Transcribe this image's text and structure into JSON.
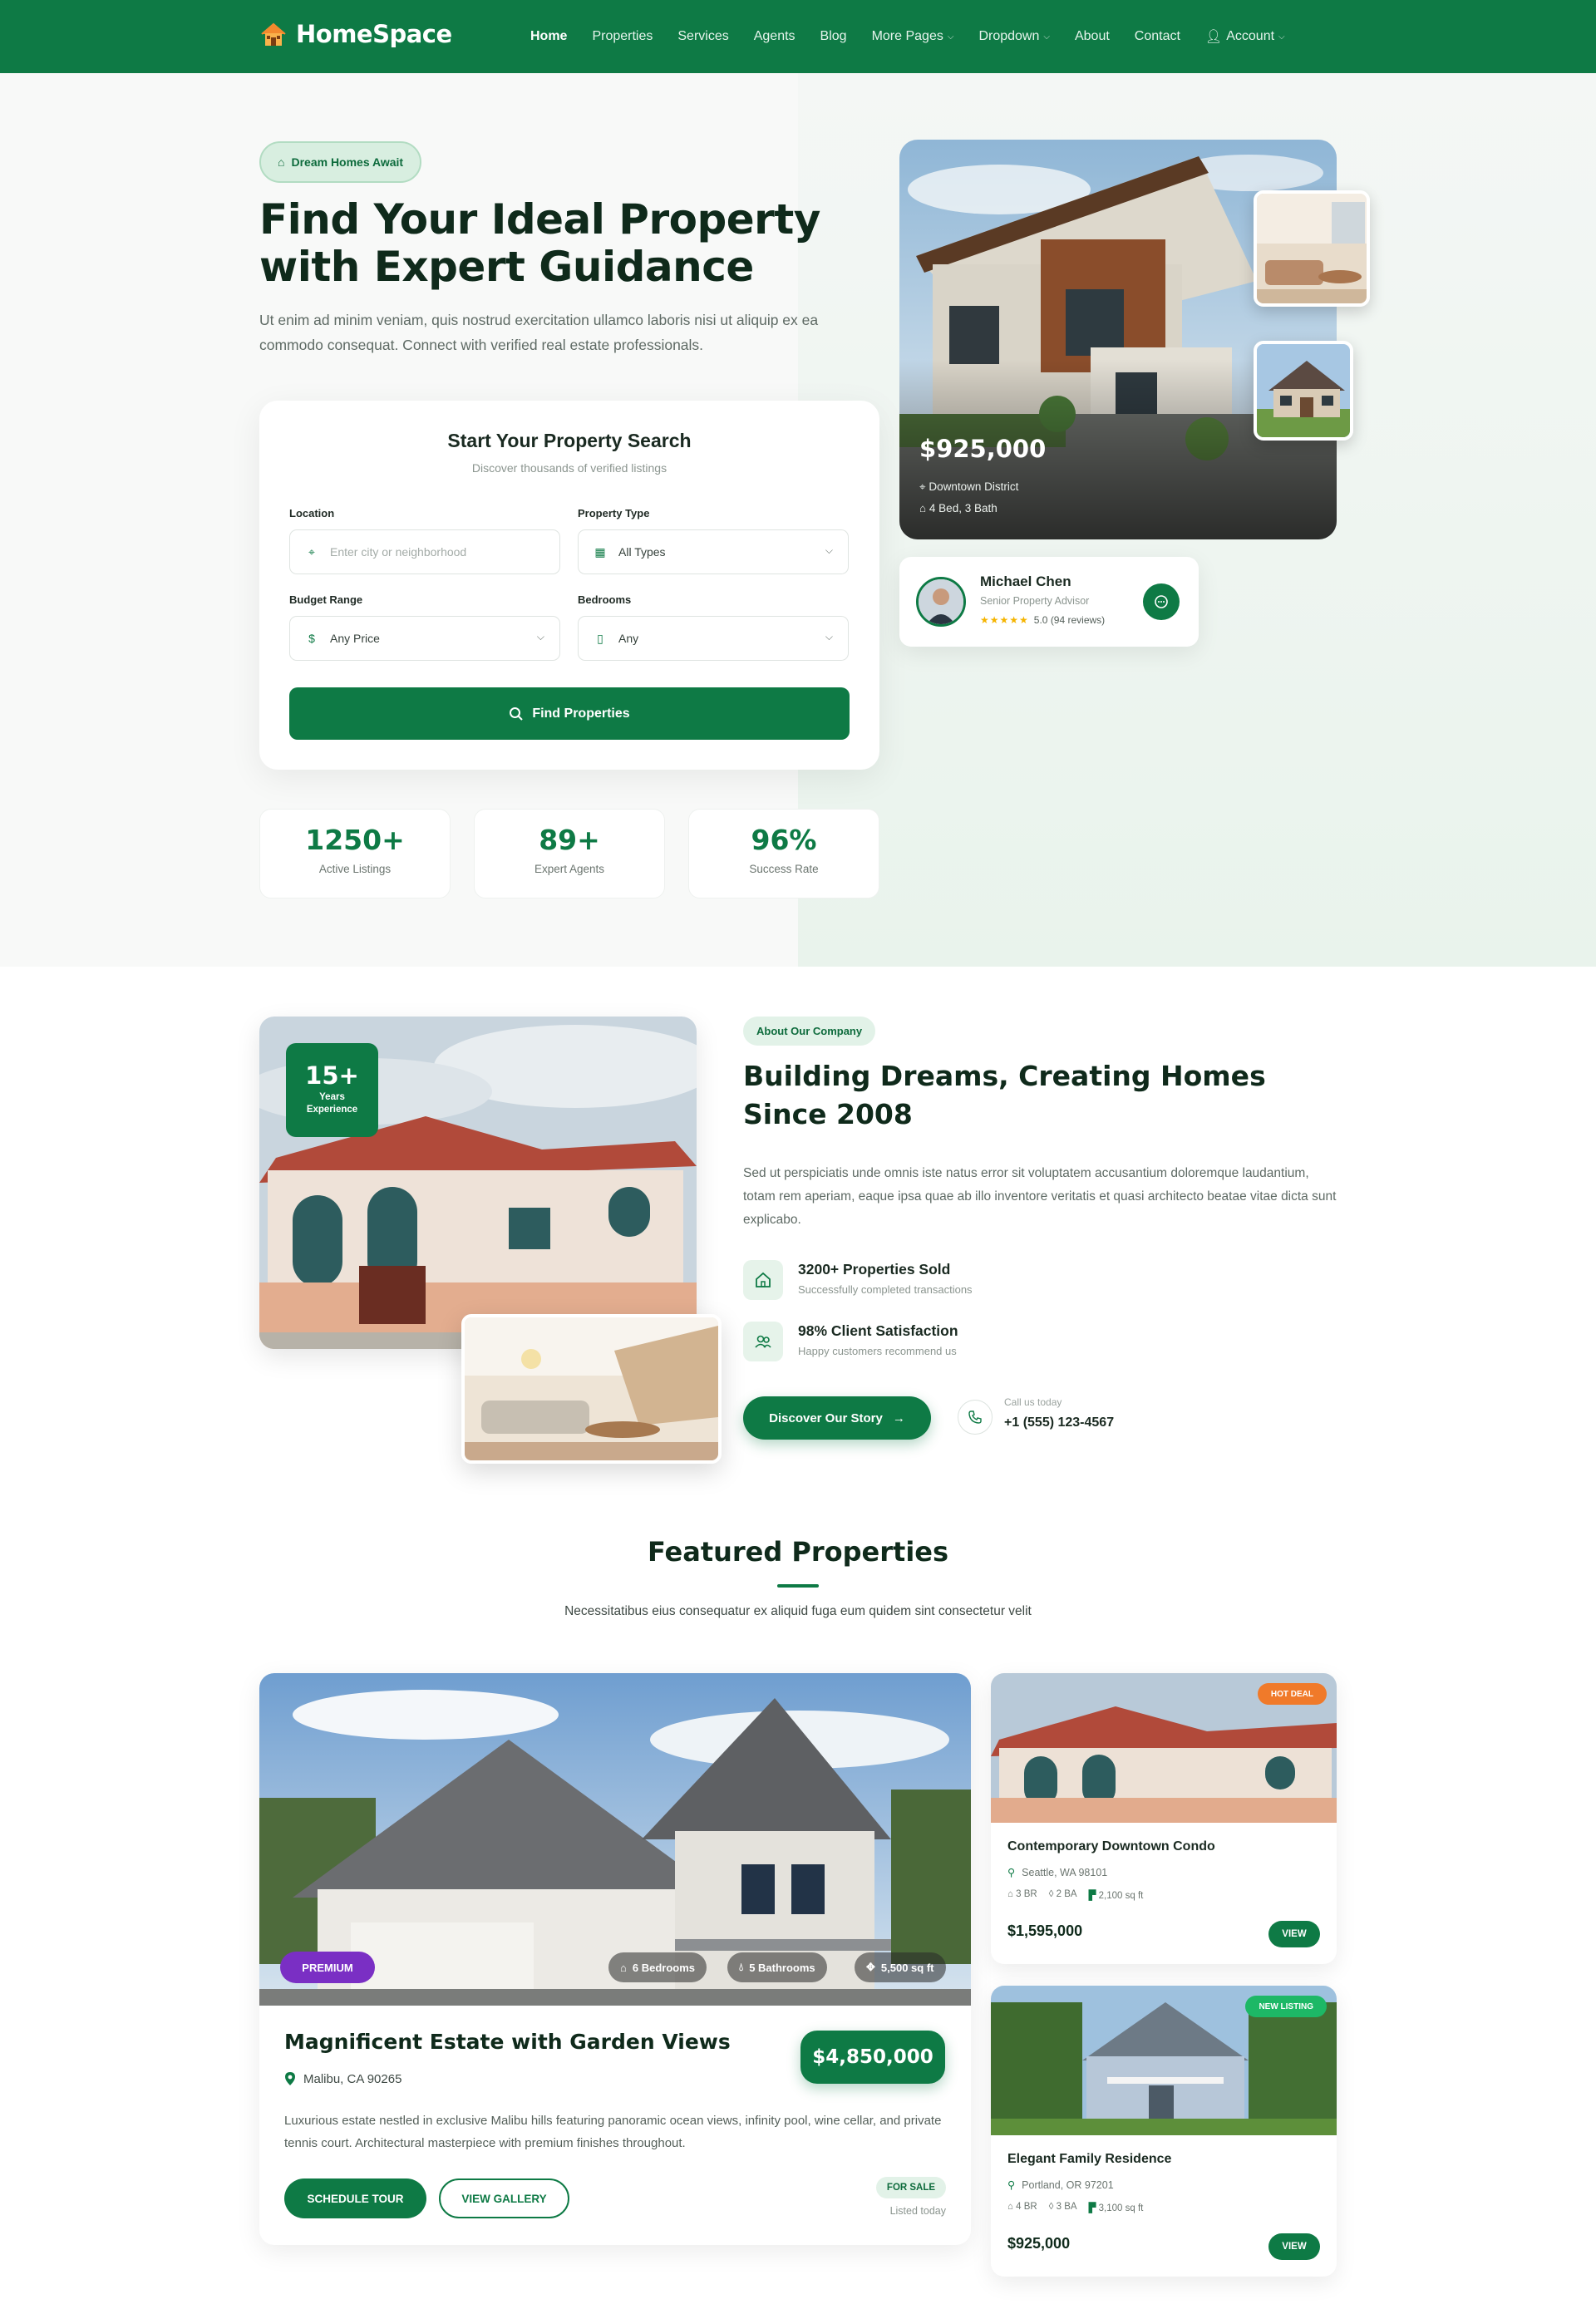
{
  "brand": {
    "name": "HomeSpace",
    "primary_color": "#0e7a45",
    "logo_icon": "house-logo-icon"
  },
  "nav": {
    "items": [
      {
        "label": "Home",
        "active": true
      },
      {
        "label": "Properties"
      },
      {
        "label": "Services"
      },
      {
        "label": "Agents"
      },
      {
        "label": "Blog"
      },
      {
        "label": "More Pages",
        "dropdown": true
      },
      {
        "label": "Dropdown",
        "dropdown": true
      },
      {
        "label": "About"
      },
      {
        "label": "Contact"
      },
      {
        "label": "Account",
        "dropdown": true,
        "icon": "user-icon"
      }
    ]
  },
  "hero": {
    "pill": "Dream Homes Await",
    "title": "Find Your Ideal Property with Expert Guidance",
    "subtitle": "Ut enim ad minim veniam, quis nostrud exercitation ullamco laboris nisi ut aliquip ex ea commodo consequat. Connect with verified real estate professionals.",
    "search": {
      "title": "Start Your Property Search",
      "subtitle": "Discover thousands of verified listings",
      "location_label": "Location",
      "location_placeholder": "Enter city or neighborhood",
      "type_label": "Property Type",
      "type_value": "All Types",
      "budget_label": "Budget Range",
      "budget_value": "Any Price",
      "bedrooms_label": "Bedrooms",
      "bedrooms_value": "Any",
      "button": "Find Properties"
    },
    "stats": [
      {
        "value": "1250+",
        "label": "Active Listings"
      },
      {
        "value": "89+",
        "label": "Expert Agents"
      },
      {
        "value": "96%",
        "label": "Success Rate"
      }
    ],
    "featured": {
      "price": "$925,000",
      "location": "Downtown District",
      "specs": "4 Bed, 3 Bath"
    },
    "agent": {
      "name": "Michael Chen",
      "role": "Senior Property Advisor",
      "stars": "★★★★★",
      "rating": "5.0 (94 reviews)"
    }
  },
  "about": {
    "badge_num": "15+",
    "badge_label_1": "Years",
    "badge_label_2": "Experience",
    "pill": "About Our Company",
    "title": "Building Dreams, Creating Homes Since 2008",
    "text": "Sed ut perspiciatis unde omnis iste natus error sit voluptatem accusantium doloremque laudantium, totam rem aperiam, eaque ipsa quae ab illo inventore veritatis et quasi architecto beatae vitae dicta sunt explicabo.",
    "features": [
      {
        "title": "3200+ Properties Sold",
        "subtitle": "Successfully completed transactions",
        "icon": "house-icon"
      },
      {
        "title": "98% Client Satisfaction",
        "subtitle": "Happy customers recommend us",
        "icon": "users-icon"
      }
    ],
    "button": "Discover Our Story",
    "call_label": "Call us today",
    "call_number": "+1 (555) 123-4567"
  },
  "featured": {
    "title": "Featured Properties",
    "subtitle": "Necessitatibus eius consequatur ex aliquid fuga eum quidem sint consectetur velit",
    "main": {
      "badge": "PREMIUM",
      "bedrooms": "6 Bedrooms",
      "bathrooms": "5 Bathrooms",
      "area": "5,500 sq ft",
      "title": "Magnificent Estate with Garden Views",
      "location": "Malibu, CA 90265",
      "price": "$4,850,000",
      "description": "Luxurious estate nestled in exclusive Malibu hills featuring panoramic ocean views, infinity pool, wine cellar, and private tennis court. Architectural masterpiece with premium finishes throughout.",
      "schedule": "SCHEDULE TOUR",
      "gallery": "VIEW GALLERY",
      "status": "FOR SALE",
      "listed": "Listed today"
    },
    "cards": [
      {
        "badge": "HOT DEAL",
        "badge_color": "#f07a2a",
        "title": "Contemporary Downtown Condo",
        "location": "Seattle, WA 98101",
        "beds": "3 BR",
        "baths": "2 BA",
        "area": "2,100 sq ft",
        "price": "$1,595,000",
        "button": "VIEW"
      },
      {
        "badge": "NEW LISTING",
        "badge_color": "#1db866",
        "title": "Elegant Family Residence",
        "location": "Portland, OR 97201",
        "beds": "4 BR",
        "baths": "3 BA",
        "area": "3,100 sq ft",
        "price": "$925,000",
        "button": "VIEW"
      }
    ]
  }
}
